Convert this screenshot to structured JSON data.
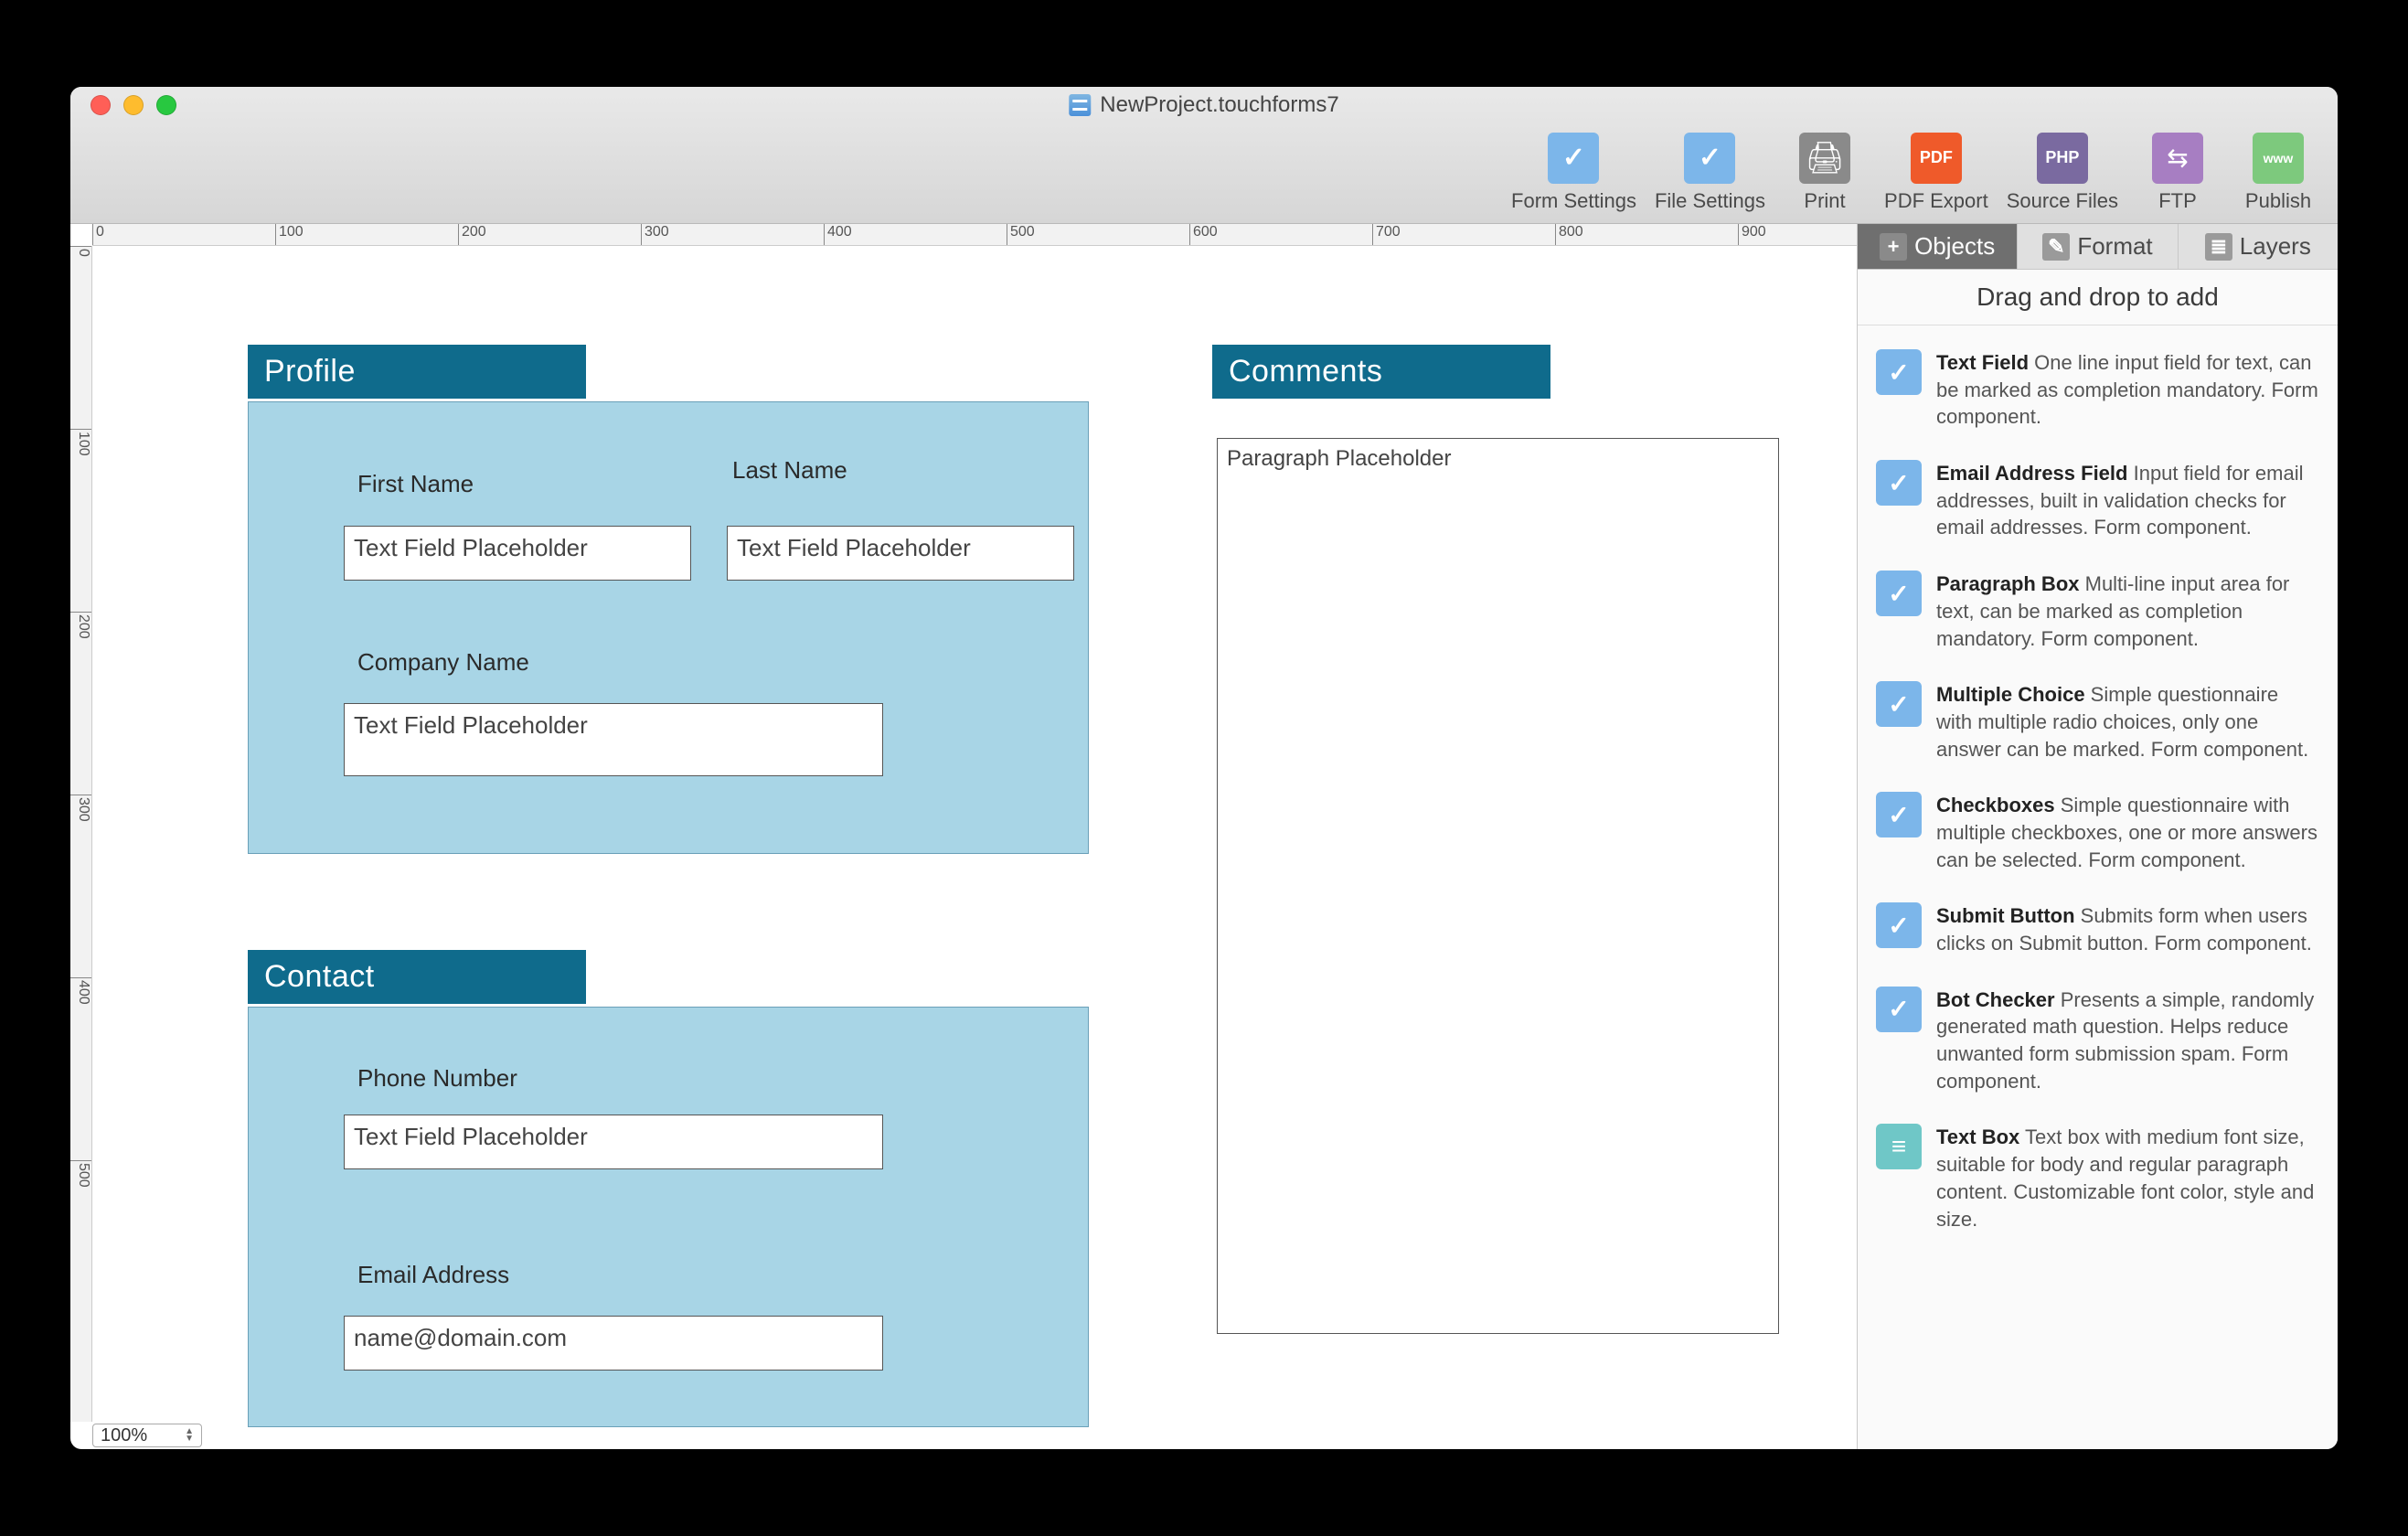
{
  "window": {
    "title": "NewProject.touchforms7"
  },
  "toolbar": [
    {
      "name": "form-settings",
      "label": "Form Settings",
      "icon": "check"
    },
    {
      "name": "file-settings",
      "label": "File Settings",
      "icon": "check"
    },
    {
      "name": "print",
      "label": "Print",
      "icon": "print"
    },
    {
      "name": "pdf-export",
      "label": "PDF Export",
      "icon": "pdf"
    },
    {
      "name": "source-files",
      "label": "Source Files",
      "icon": "php"
    },
    {
      "name": "ftp",
      "label": "FTP",
      "icon": "ftp"
    },
    {
      "name": "publish",
      "label": "Publish",
      "icon": "www"
    }
  ],
  "zoom": "100%",
  "ruler_h": [
    "0",
    "100",
    "200",
    "300",
    "400",
    "500",
    "600",
    "700",
    "800",
    "900"
  ],
  "ruler_v": [
    "0",
    "100",
    "200",
    "300",
    "400",
    "500"
  ],
  "canvas": {
    "profile_title": "Profile",
    "first_name_label": "First Name",
    "last_name_label": "Last Name",
    "company_label": "Company Name",
    "textfield_placeholder": "Text Field Placeholder",
    "contact_title": "Contact",
    "phone_label": "Phone Number",
    "email_label": "Email Address",
    "email_placeholder": "name@domain.com",
    "comments_title": "Comments",
    "paragraph_placeholder": "Paragraph Placeholder"
  },
  "inspector": {
    "tabs": {
      "objects": "Objects",
      "format": "Format",
      "layers": "Layers"
    },
    "hint": "Drag and drop to add",
    "items": [
      {
        "name": "text-field",
        "title": "Text Field",
        "desc": "One line input field for text, can be marked as completion mandatory.  Form component.",
        "icon": "checky"
      },
      {
        "name": "email-field",
        "title": "Email Address Field",
        "desc": "Input field for email addresses, built in validation checks for email addresses.  Form component.",
        "icon": "checky"
      },
      {
        "name": "paragraph-box",
        "title": "Paragraph Box",
        "desc": "Multi-line input area for text, can be marked as completion mandatory.  Form component.",
        "icon": "checky"
      },
      {
        "name": "multiple-choice",
        "title": "Multiple Choice",
        "desc": "Simple questionnaire with multiple radio choices, only one answer can be marked.  Form component.",
        "icon": "checky"
      },
      {
        "name": "checkboxes",
        "title": "Checkboxes",
        "desc": "Simple questionnaire with multiple checkboxes, one or more answers can be selected.  Form component.",
        "icon": "checky"
      },
      {
        "name": "submit-button",
        "title": "Submit Button",
        "desc": "Submits form when users clicks on Submit button.  Form component.",
        "icon": "checky"
      },
      {
        "name": "bot-checker",
        "title": "Bot Checker",
        "desc": "Presents a simple, randomly generated math question.  Helps reduce unwanted form submission spam.  Form component.",
        "icon": "checky"
      },
      {
        "name": "text-box",
        "title": "Text Box",
        "desc": "Text box with medium font size, suitable for body and regular paragraph content. Customizable font color, style and size.",
        "icon": "textbox"
      }
    ]
  }
}
